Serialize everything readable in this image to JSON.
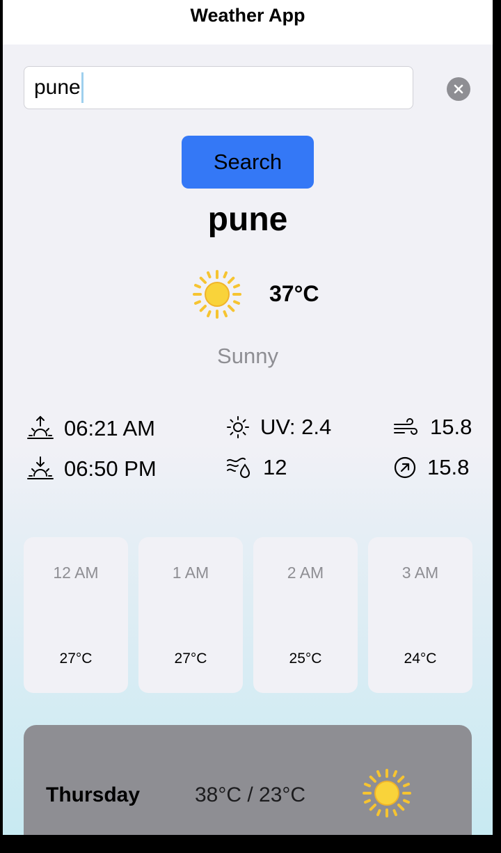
{
  "app": {
    "title": "Weather App"
  },
  "search": {
    "value": "pune",
    "button_label": "Search"
  },
  "current": {
    "city": "pune",
    "temperature": "37°C",
    "condition": "Sunny",
    "icon": "sun-icon"
  },
  "details": {
    "sunrise": "06:21 AM",
    "sunset": "06:50 PM",
    "uv": "UV: 2.4",
    "humidity": "12",
    "wind": "15.8",
    "gust": "15.8"
  },
  "hourly": [
    {
      "time": "12 AM",
      "temp": "27°C",
      "icon": "moon-icon"
    },
    {
      "time": "1 AM",
      "temp": "27°C",
      "icon": "moon-icon"
    },
    {
      "time": "2 AM",
      "temp": "25°C",
      "icon": "moon-icon"
    },
    {
      "time": "3 AM",
      "temp": "24°C",
      "icon": "moon-icon"
    }
  ],
  "daily": [
    {
      "day": "Thursday",
      "range": "38°C / 23°C",
      "icon": "sun-icon"
    }
  ],
  "colors": {
    "accent": "#3478f6",
    "secondary_text": "#8e8e93",
    "card": "#f1f1f6",
    "day_card": "#8e8e93",
    "moon": "#3478f6",
    "sun": "#f6c431"
  }
}
